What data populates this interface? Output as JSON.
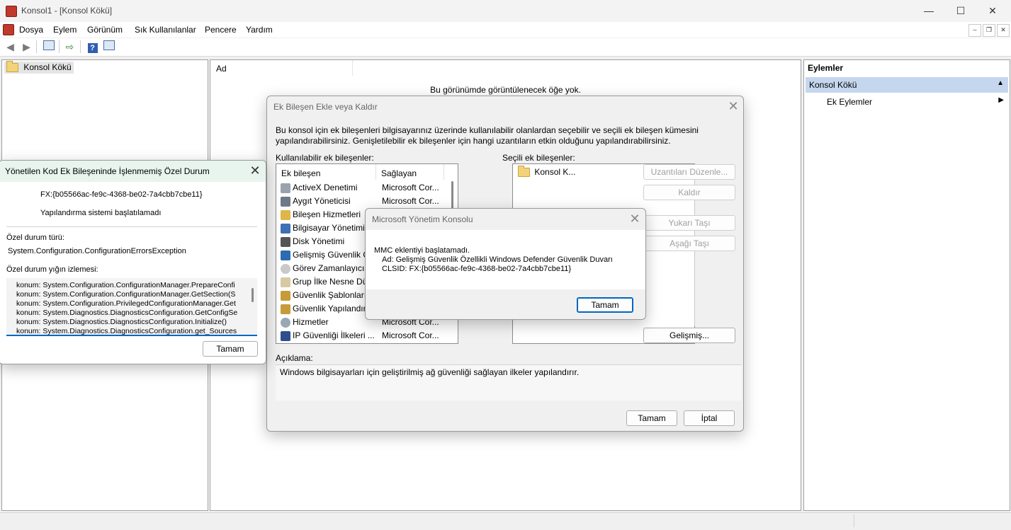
{
  "window": {
    "title": "Konsol1 - [Konsol Kökü]",
    "controls": {
      "minimize": "—",
      "maximize": "☐",
      "close": "✕"
    }
  },
  "menu": {
    "items": [
      "Dosya",
      "Eylem",
      "Görünüm",
      "Sık Kullanılanlar",
      "Pencere",
      "Yardım"
    ],
    "mdi": {
      "minimize": "–",
      "restore": "❐",
      "close": "✕"
    }
  },
  "tree": {
    "root": "Konsol Kökü"
  },
  "center": {
    "column": "Ad",
    "empty": "Bu görünümde görüntülenecek öğe yok."
  },
  "actions": {
    "header": "Eylemler",
    "section": "Konsol Kökü",
    "item": "Ek Eylemler"
  },
  "snapin_dialog": {
    "title": "Ek Bileşen Ekle veya Kaldır",
    "description": "Bu konsol için ek bileşenleri bilgisayarınız üzerinde kullanılabilir olanlardan seçebilir ve seçili ek bileşen kümesini yapılandırabilirsiniz. Genişletilebilir ek bileşenler için hangi uzantıların etkin olduğunu yapılandırabilirsiniz.",
    "available_label": "Kullanılabilir ek bileşenler:",
    "selected_label": "Seçili ek bileşenler:",
    "col_snapin": "Ek bileşen",
    "col_vendor": "Sağlayan",
    "rows": [
      {
        "name": "ActiveX Denetimi",
        "vendor": "Microsoft Cor..."
      },
      {
        "name": "Aygıt Yöneticisi",
        "vendor": "Microsoft Cor..."
      },
      {
        "name": "Bileşen Hizmetleri",
        "vendor": ""
      },
      {
        "name": "Bilgisayar Yönetimi",
        "vendor": ""
      },
      {
        "name": "Disk Yönetimi",
        "vendor": ""
      },
      {
        "name": "Gelişmiş Güvenlik Ö",
        "vendor": ""
      },
      {
        "name": "Görev Zamanlayıcı",
        "vendor": ""
      },
      {
        "name": "Grup İlke Nesne Düz",
        "vendor": ""
      },
      {
        "name": "Güvenlik Şablonları",
        "vendor": ""
      },
      {
        "name": "Güvenlik Yapılandır.",
        "vendor": ""
      },
      {
        "name": "Hizmetler",
        "vendor": "Microsoft Cor..."
      },
      {
        "name": "IP Güvenliği İlkeleri ...",
        "vendor": "Microsoft Cor..."
      }
    ],
    "selected_item": "Konsol K...",
    "btn_edit_ext": "Uzantıları Düzenle...",
    "btn_remove": "Kaldır",
    "btn_up": "Yukarı Taşı",
    "btn_down": "Aşağı Taşı",
    "btn_advanced": "Gelişmiş...",
    "desc_label": "Açıklama:",
    "desc_text": "Windows bilgisayarları için geliştirilmiş ağ güvenliği sağlayan ilkeler yapılandırır.",
    "ok": "Tamam",
    "cancel": "İptal"
  },
  "mmc_dialog": {
    "title": "Microsoft Yönetim Konsolu",
    "line1": "MMC eklentiyi başlatamadı.",
    "line2": "Ad: Gelişmiş Güvenlik Özellikli Windows Defender Güvenlik Duvarı",
    "line3": "CLSID: FX:{b05566ac-fe9c-4368-be02-7a4cbb7cbe11}",
    "ok": "Tamam"
  },
  "exception_dialog": {
    "title": "Yönetilen Kod Ek Bileşeninde İşlenmemiş Özel Durum",
    "fx": "FX:{b05566ac-fe9c-4368-be02-7a4cbb7cbe11}",
    "message": "Yapılandırma sistemi başlatılamadı",
    "type_label": "Özel durum türü:",
    "type_value": "System.Configuration.ConfigurationErrorsException",
    "stack_label": "Özel durum yığın izlemesi:",
    "stack": [
      "konum: System.Configuration.ConfigurationManager.PrepareConfi",
      "konum: System.Configuration.ConfigurationManager.GetSection(S",
      "konum: System.Configuration.PrivilegedConfigurationManager.Get",
      "konum: System.Diagnostics.DiagnosticsConfiguration.GetConfigSe",
      "konum: System.Diagnostics.DiagnosticsConfiguration.Initialize()",
      "konum: System.Diagnostics.DiagnosticsConfiguration.get_Sources"
    ],
    "ok": "Tamam"
  },
  "colors": {
    "accent": "#0067c0",
    "actions_section_bg": "#c5d7ee",
    "exception_title_bg": "#e8f5ee"
  }
}
